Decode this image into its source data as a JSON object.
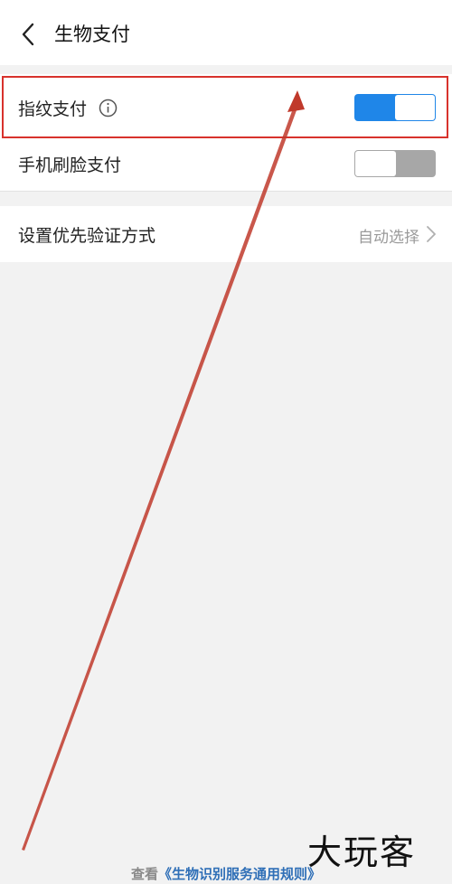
{
  "header": {
    "title": "生物支付",
    "back_icon": "chevron-left-icon"
  },
  "settings": {
    "fingerprint": {
      "label": "指纹支付",
      "info_icon": "info-circle-icon",
      "enabled": true
    },
    "face": {
      "label": "手机刷脸支付",
      "enabled": false
    },
    "priority": {
      "label": "设置优先验证方式",
      "value": "自动选择",
      "chevron_icon": "chevron-right-icon"
    }
  },
  "footer": {
    "prefix": "查看",
    "link": "《生物识别服务通用规则》"
  },
  "watermark": {
    "text": "大玩客"
  },
  "colors": {
    "toggle_on": "#1f86e8",
    "toggle_off": "#a7a7a7",
    "highlight": "#d8322c",
    "link": "#2f6fb7"
  }
}
